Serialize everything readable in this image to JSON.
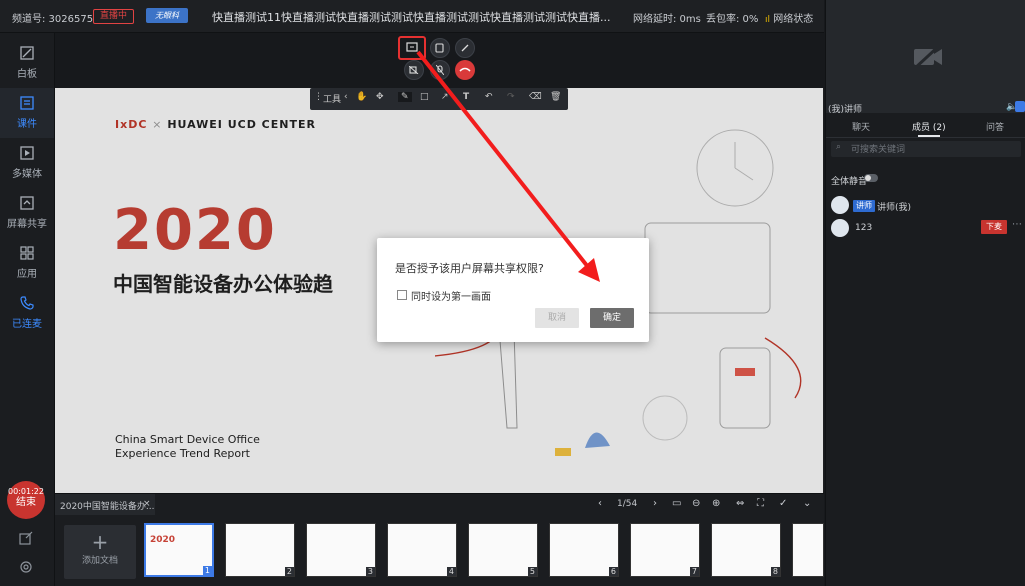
{
  "topbar": {
    "channel": "频道号: 3026575",
    "live_badge": "直播中",
    "logo_badge": "无眼科",
    "title": "快直播测试11快直播测试快直播测试测试快直播测试测试快直播测试测试快直播...",
    "latency": "网络延时: 0ms",
    "loss": "丢包率: 0%",
    "net_status": "网络状态"
  },
  "sidebar": {
    "items": [
      {
        "label": "白板"
      },
      {
        "label": "课件"
      },
      {
        "label": "多媒体"
      },
      {
        "label": "屏幕共享"
      },
      {
        "label": "应用"
      },
      {
        "label": "已连麦"
      }
    ],
    "timer": "00:01:22",
    "end_label": "结束"
  },
  "draw_toolbar": {
    "tools_label": "工具"
  },
  "slide": {
    "logo_a": "IxDC",
    "logo_sep": "×",
    "logo_b": "HUAWEI UCD CENTER",
    "year": "2020",
    "title": "中国智能设备办公体验趋",
    "en_line1": "China Smart Device Office",
    "en_line2": "Experience Trend Report"
  },
  "dialog": {
    "question": "是否授予该用户屏幕共享权限?",
    "checkbox_label": "同时设为第一画面",
    "cancel": "取消",
    "ok": "确定"
  },
  "docbar": {
    "doc_name": "2020中国智能设备办...",
    "close": "×",
    "page": "1/54",
    "add_doc": "添加文档",
    "thumb_numbers": [
      "1",
      "2",
      "3",
      "4",
      "5",
      "6",
      "7",
      "8"
    ]
  },
  "right": {
    "video_label": "(我)讲师",
    "tabs": [
      "聊天",
      "成员 (2)",
      "问答"
    ],
    "search_placeholder": "可搜索关键词",
    "mute_all": "全体静音",
    "members": [
      {
        "badge": "讲师",
        "name": "讲师(我)"
      },
      {
        "name": "123",
        "action": "下麦"
      }
    ]
  }
}
